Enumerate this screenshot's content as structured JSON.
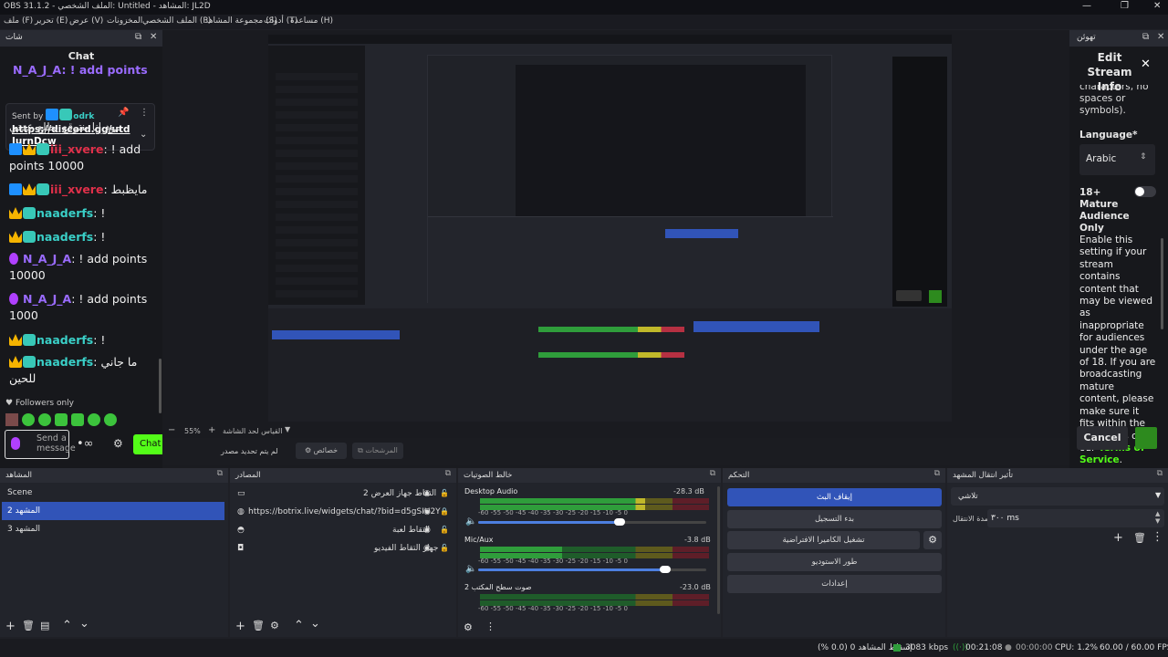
{
  "window": {
    "title": "OBS 31.1.2 - الملف الشخصي: Untitled - المشاهد: JL2D"
  },
  "menu": [
    "مساعدة (H)",
    "أدوات (T)",
    "مجموعة المشاهد (S)",
    "الملف الشخصي (P)",
    "المخزونات",
    "عرض (V)",
    "تحرير (E)",
    "ملف (F)"
  ],
  "chat_dock": {
    "title": "Chat",
    "header_label": "شات",
    "pinned": {
      "sent_by": "Sent by",
      "user": "odrk",
      "text": "https://discord.gg/utdJurnDcw"
    },
    "partial_top": "N_A_J_A: ! add points",
    "partial_mid": "مود انا بنتوقع يطلع عدتي",
    "messages": [
      {
        "user": "iii_xvere",
        "text": ": ! add points 10000"
      },
      {
        "user": "iii_xvere",
        "text": ": مايظبط"
      },
      {
        "user": "naaderfs",
        "text": ": !"
      },
      {
        "user": "naaderfs",
        "text": ": !"
      },
      {
        "user": "N_A_J_A",
        "text": ": ! add points 10000"
      },
      {
        "user": "N_A_J_A",
        "text": ": ! add points 1000"
      },
      {
        "user": "naaderfs",
        "text": ": !"
      },
      {
        "user": "naaderfs",
        "text": ": ما جاني للحين"
      }
    ],
    "followers_only": "Followers only",
    "send_placeholder": "Send a message",
    "chat_button": "Chat"
  },
  "preview": {
    "zoom": "55%",
    "zoom_label": "القياس لحد الشاشة",
    "record_label": "لم يتم تحديد مصدر",
    "props_label": "خصائص",
    "filters_label": "المرشحات"
  },
  "stream_info": {
    "dock_label": "تهوئن",
    "title": "Edit Stream Info",
    "partial": "characters, no spaces or symbols).",
    "language_label": "Language*",
    "language_value": "Arabic",
    "mature_label": "18+ Mature Audience Only",
    "mature_desc": "Enable this setting if your stream contains content that may be viewed as inappropriate for audiences under the age of 18. If you are broadcasting mature content, please make sure it fits within the guidelines of our",
    "tos": "Terms of Service",
    "cancel": "Cancel"
  },
  "scenes": {
    "title": "المشاهد",
    "items": [
      "Scene",
      "المشهد 2",
      "المشهد 3"
    ],
    "selected": 1
  },
  "sources": {
    "title": "المصادر",
    "items": [
      "التقاط جهاز العرض 2",
      "https://botrix.live/widgets/chat/?bid=d5gSIU2Y",
      "التقاط لعبة",
      "جهاز التقاط الفيديو"
    ]
  },
  "mixer": {
    "title": "خالط الصوتيات",
    "tracks": [
      {
        "name": "Desktop Audio",
        "db": "-28.3 dB",
        "level": 0.72,
        "volume": 0.62
      },
      {
        "name": "Mic/Aux",
        "db": "-3.8 dB",
        "level": 0.36,
        "volume": 0.82
      },
      {
        "name": "صوت سطح المكتب 2",
        "db": "-23.0 dB",
        "level": 0,
        "volume": 0.7
      }
    ],
    "ticks": "-60  -55  -50  -45  -40  -35  -30  -25  -20  -15  -10   -5   0"
  },
  "controls": {
    "title": "التحكم",
    "buttons": [
      "إيقاف البث",
      "بدء التسجيل",
      "تشغيل الكاميرا الافتراضية",
      "طور الاستوديو",
      "إعدادات"
    ]
  },
  "transitions": {
    "title": "تأثير انتقال المشهد",
    "value": "تلاشي",
    "duration_label": "مدة الانتقال",
    "duration": "٣٠٠ ms"
  },
  "status": {
    "dropped": "إسقاط المشاهد 0 (0.0 %)",
    "kbps": "3083 kbps",
    "live_time": "00:21:08",
    "rec_time": "00:00:00",
    "cpu": "CPU: 1.2%",
    "fps": "60.00 / 60.00 FPS"
  }
}
